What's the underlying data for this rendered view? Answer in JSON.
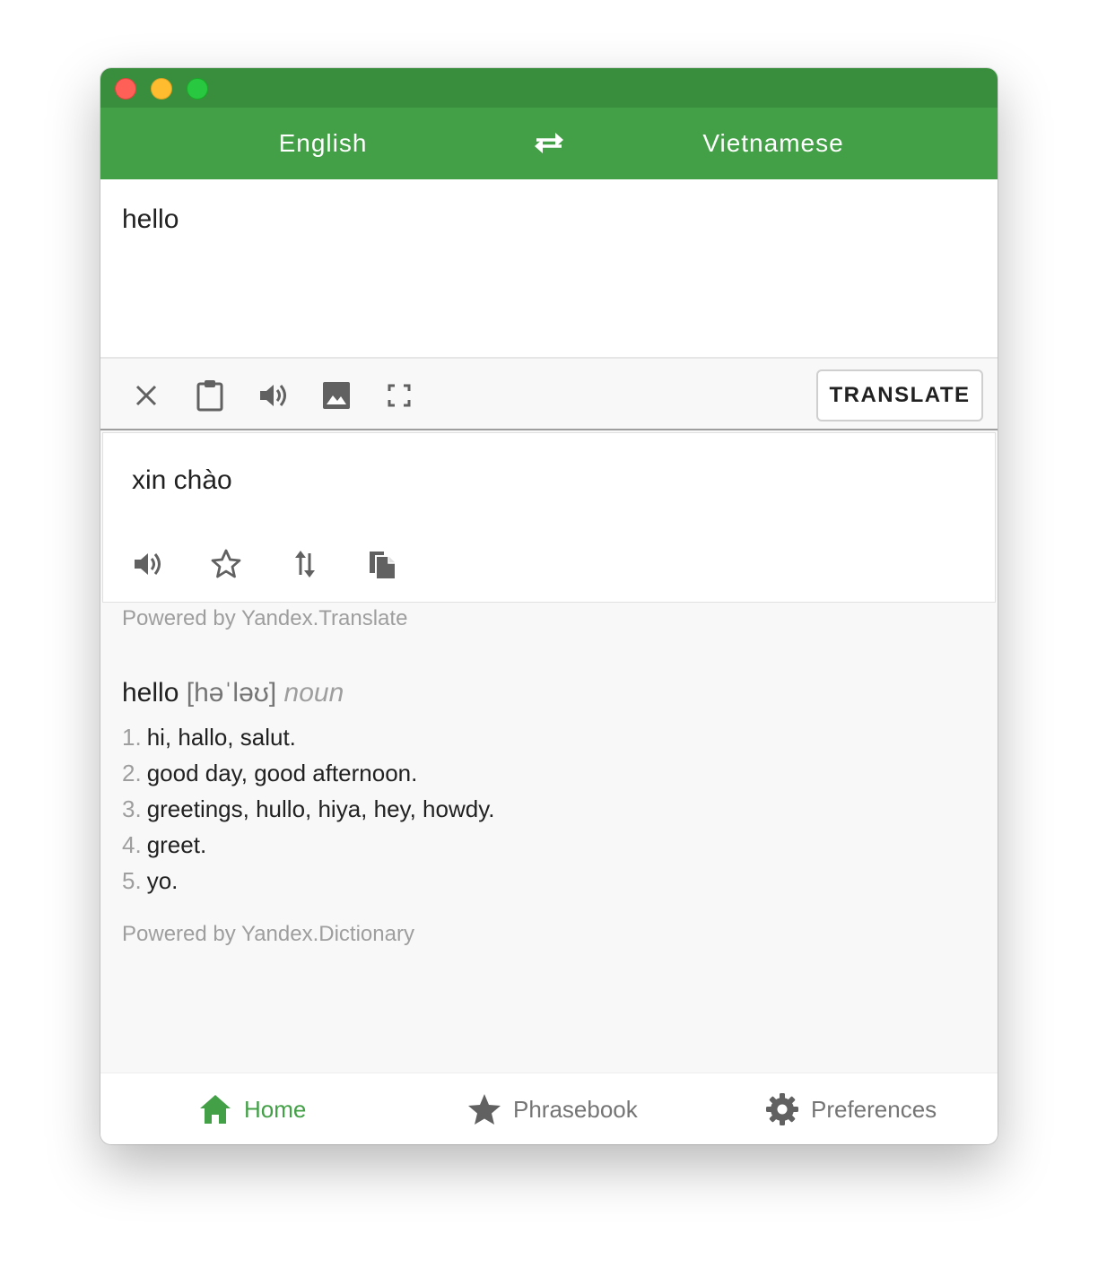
{
  "header": {
    "source_language": "English",
    "target_language": "Vietnamese"
  },
  "input": {
    "value": "hello"
  },
  "toolbar": {
    "translate_label": "TRANSLATE"
  },
  "result": {
    "text": "xin chào",
    "powered_by": "Powered by Yandex.Translate"
  },
  "dictionary": {
    "word": "hello",
    "phonetic": "[həˈləʊ]",
    "part_of_speech": "noun",
    "definitions": [
      {
        "num": "1.",
        "text": "hi, hallo, salut."
      },
      {
        "num": "2.",
        "text": "good day, good afternoon."
      },
      {
        "num": "3.",
        "text": "greetings, hullo, hiya, hey, howdy."
      },
      {
        "num": "4.",
        "text": "greet."
      },
      {
        "num": "5.",
        "text": "yo."
      }
    ],
    "powered_by": "Powered by Yandex.Dictionary"
  },
  "nav": {
    "home": "Home",
    "phrasebook": "Phrasebook",
    "preferences": "Preferences"
  },
  "colors": {
    "titlebar": "#388e3c",
    "appbar": "#43a047",
    "accent": "#43a047",
    "icon": "#616161"
  },
  "icons": [
    "swap-icon",
    "close-icon",
    "clipboard-icon",
    "speaker-icon",
    "image-icon",
    "fullscreen-icon",
    "star-outline-icon",
    "swap-vertical-icon",
    "copy-icon",
    "home-icon",
    "star-icon",
    "gear-icon"
  ]
}
